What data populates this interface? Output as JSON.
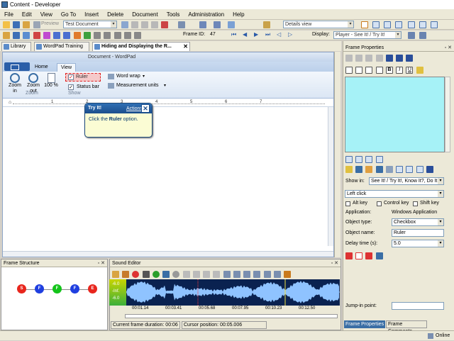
{
  "window": {
    "title": "Content - Developer"
  },
  "menu": [
    "File",
    "Edit",
    "View",
    "Go To",
    "Insert",
    "Delete",
    "Document",
    "Tools",
    "Administration",
    "Help"
  ],
  "toolbar1": {
    "preview_label": "Preview",
    "document_combo": "Test Document",
    "view_combo": "Details view"
  },
  "toolbar2": {
    "frame_id_label": "Frame ID:",
    "frame_id_value": "47",
    "display_label": "Display:",
    "display_combo": "Player - See It! / Try It!"
  },
  "tabs": [
    {
      "label": "Library"
    },
    {
      "label": "WordPad Training"
    },
    {
      "label": "Hiding and Displaying the R..."
    }
  ],
  "wordpad": {
    "title": "Document - WordPad",
    "tab_home": "Home",
    "tab_view": "View",
    "zoom_in": "Zoom in",
    "zoom_out": "Zoom out",
    "zoom_100": "100 %",
    "group_zoom": "Zoom",
    "group_show": "Show",
    "ruler_label": "Ruler",
    "statusbar_label": "Status bar",
    "word_wrap": "Word wrap",
    "measurement_units": "Measurement units",
    "ruler_marks": [
      "1",
      "2",
      "3",
      "4",
      "5",
      "6",
      "7"
    ]
  },
  "tooltip": {
    "title": "Try It!",
    "actions": "Actions",
    "body_prefix": "Click the ",
    "body_bold": "Ruler",
    "body_suffix": " option."
  },
  "frame_structure": {
    "title": "Frame Structure",
    "nodes": [
      {
        "label": "S",
        "color": "#e8261d"
      },
      {
        "label": "F",
        "color": "#1f3fe0"
      },
      {
        "label": "F",
        "color": "#13c41a"
      },
      {
        "label": "F",
        "color": "#1f3fe0"
      },
      {
        "label": "E",
        "color": "#e8261d"
      }
    ]
  },
  "sound_editor": {
    "title": "Sound Editor",
    "db_labels": [
      "-6.0",
      "-Inf.",
      "-6.0"
    ],
    "timeline": [
      "00:01.14",
      "00:03.41",
      "00:05.68",
      "00:07.95",
      "00:10.23",
      "00:12.50"
    ],
    "frame_duration": "Current frame duration: 00:06",
    "cursor_position": "Cursor position: 00:05.006"
  },
  "frame_properties": {
    "title": "Frame Properties",
    "show_in_label": "Show in:",
    "show_in_value": "See It! / Try It!, Know It?, Do It!",
    "action_value": "Left click",
    "alt_key": "Alt key",
    "control_key": "Control key",
    "shift_key": "Shift key",
    "application_label": "Application:",
    "application_value": "Windows Application",
    "object_type_label": "Object type:",
    "object_type_value": "Checkbox",
    "object_name_label": "Object name:",
    "object_name_value": "Ruler",
    "delay_label": "Delay time (s):",
    "delay_value": "5.0",
    "jump_in_label": "Jump-in point:",
    "tab_properties": "Frame Properties",
    "tab_comments": "Frame Comments"
  },
  "status": {
    "online": "Online"
  }
}
